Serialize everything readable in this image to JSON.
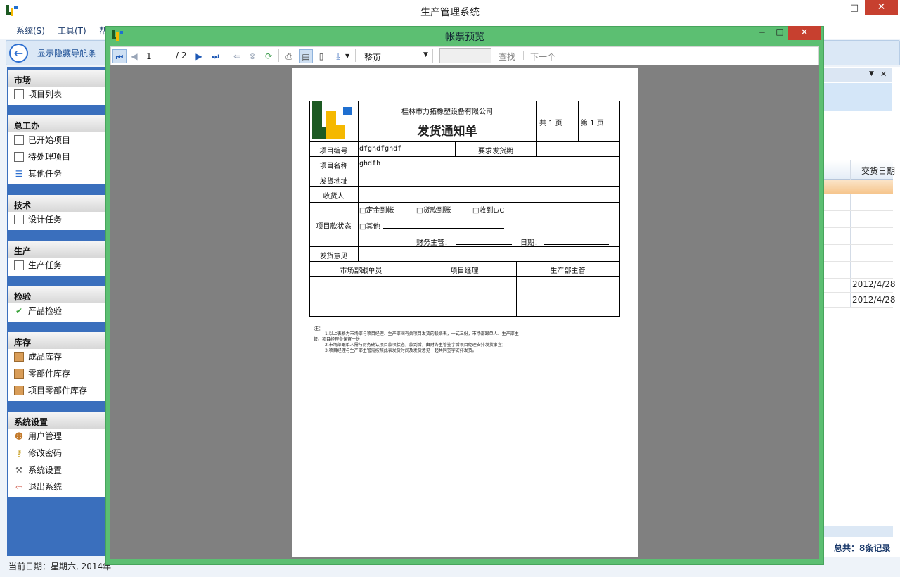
{
  "main_window": {
    "title": "生产管理系统",
    "menu": [
      "系统(S)",
      "工具(T)",
      "帮"
    ],
    "nav_toggle": "显示隐藏导航条",
    "min": "‒",
    "max": "□",
    "close": "✕"
  },
  "sidebar": {
    "sections": [
      {
        "title": "市场",
        "items": [
          "项目列表"
        ]
      },
      {
        "title": "总工办",
        "items": [
          "已开始项目",
          "待处理项目",
          "其他任务"
        ]
      },
      {
        "title": "技术",
        "items": [
          "设计任务"
        ]
      },
      {
        "title": "生产",
        "items": [
          "生产任务"
        ]
      },
      {
        "title": "检验",
        "items": [
          "产品检验"
        ]
      },
      {
        "title": "库存",
        "items": [
          "成品库存",
          "零部件库存",
          "项目零部件库存"
        ]
      },
      {
        "title": "系统设置",
        "items": [
          "用户管理",
          "修改密码",
          "系统设置",
          "退出系统"
        ]
      }
    ]
  },
  "right_panel": {
    "column_header": "交货日期",
    "dates": [
      "2012/4/28",
      "2012/4/28"
    ],
    "total": "总共：8条记录"
  },
  "status_bar": {
    "text": "当前日期：星期六, 2014年"
  },
  "dialog": {
    "title": "帐票预览",
    "min": "‒",
    "max": "□",
    "close": "✕",
    "toolbar": {
      "page": "1",
      "page_total": "/ 2",
      "zoom": "整页",
      "find": "查找",
      "next": "下一个"
    }
  },
  "form": {
    "company": "桂林市力拓橡塑设备有限公司",
    "title": "发货通知单",
    "total_pages": "共  1  页",
    "page_no": "第  1  页",
    "project_no_label": "项目编号",
    "project_no": "dfghdfghdf",
    "delivery_req_label": "要求发货期",
    "project_name_label": "项目名称",
    "project_name": "ghdfh",
    "address_label": "发货地址",
    "receiver_label": "收货人",
    "payment_label": "项目款状态",
    "opt1": "□定金到帐",
    "opt2": "□货款到账",
    "opt3": "□收到L/C",
    "opt4": "□其他",
    "finance_label": "财务主管：",
    "date_label": "日期：",
    "opinion_label": "发货意见",
    "sign1": "市场部跟单员",
    "sign2": "项目经理",
    "sign3": "生产部主管",
    "note_head": "注：",
    "note1": "1.以上表格为市场部与项目经理、生产部间有关项目发货的联络表，一式三份，市场部跟单人、生产部主",
    "note1b": "管、项目经理各保留一份；",
    "note2": "2.市场部跟单人需与财务确认项目款项状态，款到后，由财务主管签字后项目经理安排发货事宜；",
    "note3": "3.项目经理与生产部主管需按照此表发货时间及发货意见一起共同签字安排发货。"
  },
  "colors": {
    "dialog_frame": "#5cbf72",
    "sidebar": "#3a6fbd",
    "close": "#c7402f"
  }
}
